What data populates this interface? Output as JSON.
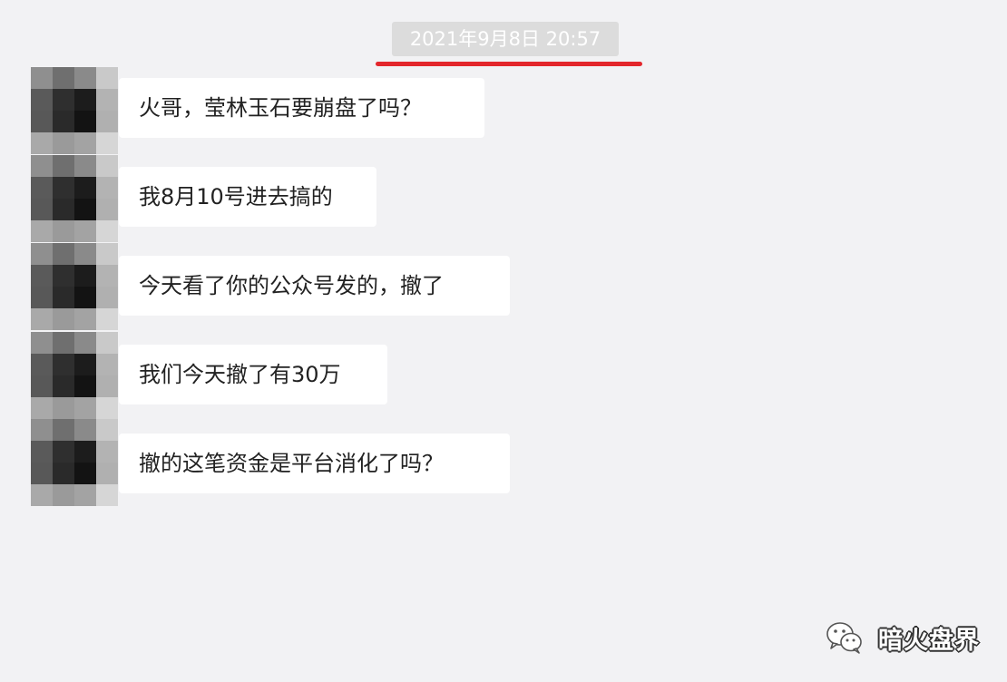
{
  "chat": {
    "timestamp": "2021年9月8日  20:57",
    "messages": [
      {
        "text": "火哥，莹林玉石要崩盘了吗？"
      },
      {
        "text": "我8月10号进去搞的"
      },
      {
        "text": "今天看了你的公众号发的，撤了"
      },
      {
        "text": "我们今天撤了有30万"
      },
      {
        "text": "撤的这笔资金是平台消化了吗？"
      }
    ]
  },
  "watermark": {
    "text": "暗火盘界",
    "icon": "wechat-icon"
  },
  "colors": {
    "background": "#f2f2f4",
    "bubble": "#ffffff",
    "timestamp_bg": "#dcdcdc",
    "underline": "#e3262b"
  }
}
